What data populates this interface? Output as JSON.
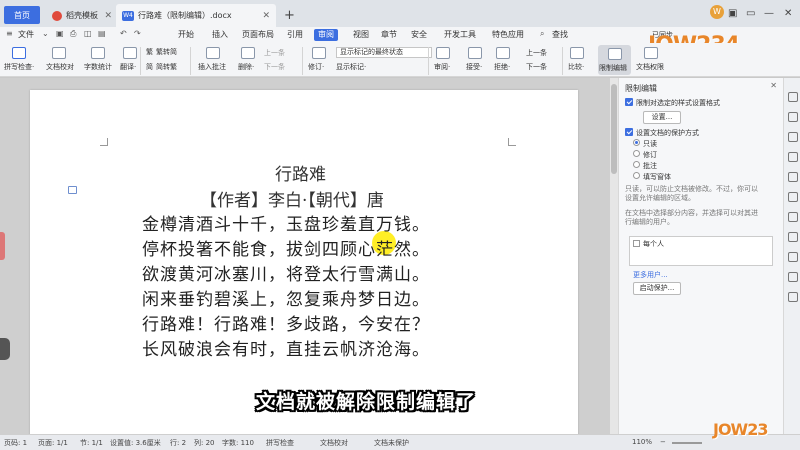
{
  "tabs": {
    "home": "首页",
    "template": "稻壳模板",
    "doc": "行路难（限制编辑）.docx",
    "doc_icon": "W4",
    "new": "+"
  },
  "window": {
    "badge": "W",
    "min": "—",
    "max": "❐",
    "close": "✕",
    "restore": "▭",
    "grid": "▣"
  },
  "menu": {
    "file": "文件",
    "items": [
      "开始",
      "插入",
      "页面布局",
      "引用",
      "审阅",
      "视图",
      "章节",
      "安全",
      "开发工具",
      "特色应用"
    ],
    "active": "审阅",
    "search": "查找",
    "collab": "已同步",
    "share": "分享"
  },
  "ribbon": {
    "spellcheck": "拼写检查·",
    "doc_check": "文档校对",
    "word_count": "字数统计",
    "translate": "翻译·",
    "trad": "繁转简",
    "simp": "简转繁",
    "insert_comment": "插入批注",
    "delete": "删除·",
    "prev_c": "上一条",
    "next_c": "下一条",
    "track": "修订·",
    "show_markup": "显示标记的最终状态",
    "show_mark": "显示标记·",
    "review": "审阅·",
    "accept": "接受·",
    "reject": "拒绝·",
    "prev": "上一条",
    "next": "下一条",
    "compare": "比较·",
    "restrict": "限制编辑",
    "permission": "文档权限",
    "logo": "JOW234"
  },
  "document": {
    "title": "行路难",
    "author": "【作者】李白·【朝代】唐",
    "lines": [
      "金樽清酒斗十千，玉盘珍羞直万钱。",
      "停杯投箸不能食，拔剑四顾心茫然。",
      "欲渡黄河冰塞川，将登太行雪满山。",
      "闲来垂钓碧溪上，忽复乘舟梦日边。",
      "行路难！行路难！多歧路，今安在？",
      "长风破浪会有时，直挂云帆济沧海。"
    ],
    "subtitle": "文档就被解除限制编辑了"
  },
  "panel": {
    "title": "限制编辑",
    "close": "✕",
    "opt1": "限制对选定的样式设置格式",
    "settings_btn": "设置...",
    "opt2": "设置文档的保护方式",
    "radios": [
      "只读",
      "修订",
      "批注",
      "填写窗体"
    ],
    "radio_selected": 0,
    "desc1": "只读，可以防止文档被修改。不过，你可以",
    "desc2": "设置允许编辑的区域。",
    "desc3": "在文档中选择部分内容，并选择可以对其进",
    "desc4": "行编辑的用户。",
    "everyone": "每个人",
    "more_users": "更多用户...",
    "start_protect": "启动保护..."
  },
  "status": {
    "page": "页码: 1",
    "pages": "页面: 1/1",
    "section": "节: 1/1",
    "setting": "设置值: 3.6厘米",
    "row": "行: 2",
    "col": "列: 20",
    "words": "字数: 110",
    "spell": "拼写检查",
    "proof": "文档校对",
    "unprotected": "文档未保护",
    "zoom": "110%",
    "logo": "JOW23"
  }
}
